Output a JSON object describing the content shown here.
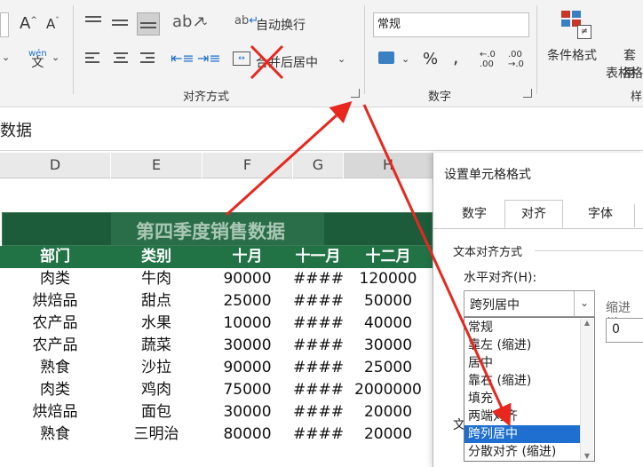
{
  "ribbon": {
    "font_group": {
      "grow_icon": "A",
      "shrink_icon": "A",
      "phonetic_icon": "wén"
    },
    "alignment_group": {
      "label": "对齐方式",
      "wrap_text": "自动换行",
      "merge_center": "合并后居中"
    },
    "number_group": {
      "label": "数字",
      "format_value": "常规",
      "percent": "%",
      "comma": ",",
      "inc_decimal": "←.0\n.00",
      "dec_decimal": ".00\n→.0"
    },
    "styles_group": {
      "conditional_format": "条件格式",
      "table_format_top": "套用",
      "table_format_bottom": "表格格",
      "label": "样"
    }
  },
  "formula_bar": {
    "value": "数据"
  },
  "columns": [
    "D",
    "E",
    "F",
    "G",
    "H"
  ],
  "sheet": {
    "title": "第四季度销售数据",
    "headers": [
      "部门",
      "类别",
      "十月",
      "十一月",
      "十二月"
    ],
    "rows": [
      [
        "肉类",
        "牛肉",
        "90000",
        "####",
        "120000"
      ],
      [
        "烘焙品",
        "甜点",
        "25000",
        "####",
        "50000"
      ],
      [
        "农产品",
        "水果",
        "10000",
        "####",
        "40000"
      ],
      [
        "农产品",
        "蔬菜",
        "30000",
        "####",
        "30000"
      ],
      [
        "熟食",
        "沙拉",
        "90000",
        "####",
        "25000"
      ],
      [
        "肉类",
        "鸡肉",
        "75000",
        "####",
        "2000000"
      ],
      [
        "烘焙品",
        "面包",
        "30000",
        "####",
        "20000"
      ],
      [
        "熟食",
        "三明治",
        "80000",
        "####",
        "20000"
      ]
    ]
  },
  "dialog": {
    "title": "设置单元格格式",
    "tabs": [
      "数字",
      "对齐",
      "字体"
    ],
    "active_tab": "对齐",
    "section_label": "文本对齐方式",
    "horizontal_label": "水平对齐(H):",
    "horizontal_value": "跨列居中",
    "indent_label": "缩进(I)",
    "indent_value": "0",
    "options": [
      "常规",
      "靠左 (缩进)",
      "居中",
      "靠右 (缩进)",
      "填充",
      "两端对齐",
      "跨列居中",
      "分散对齐 (缩进)"
    ],
    "selected_option": "跨列居中",
    "partial_label": "文"
  },
  "colors": {
    "header_green": "#217346",
    "title_green": "#1d5c3a",
    "title_text": "#a9c7b4",
    "arrow_red": "#e8271e"
  }
}
